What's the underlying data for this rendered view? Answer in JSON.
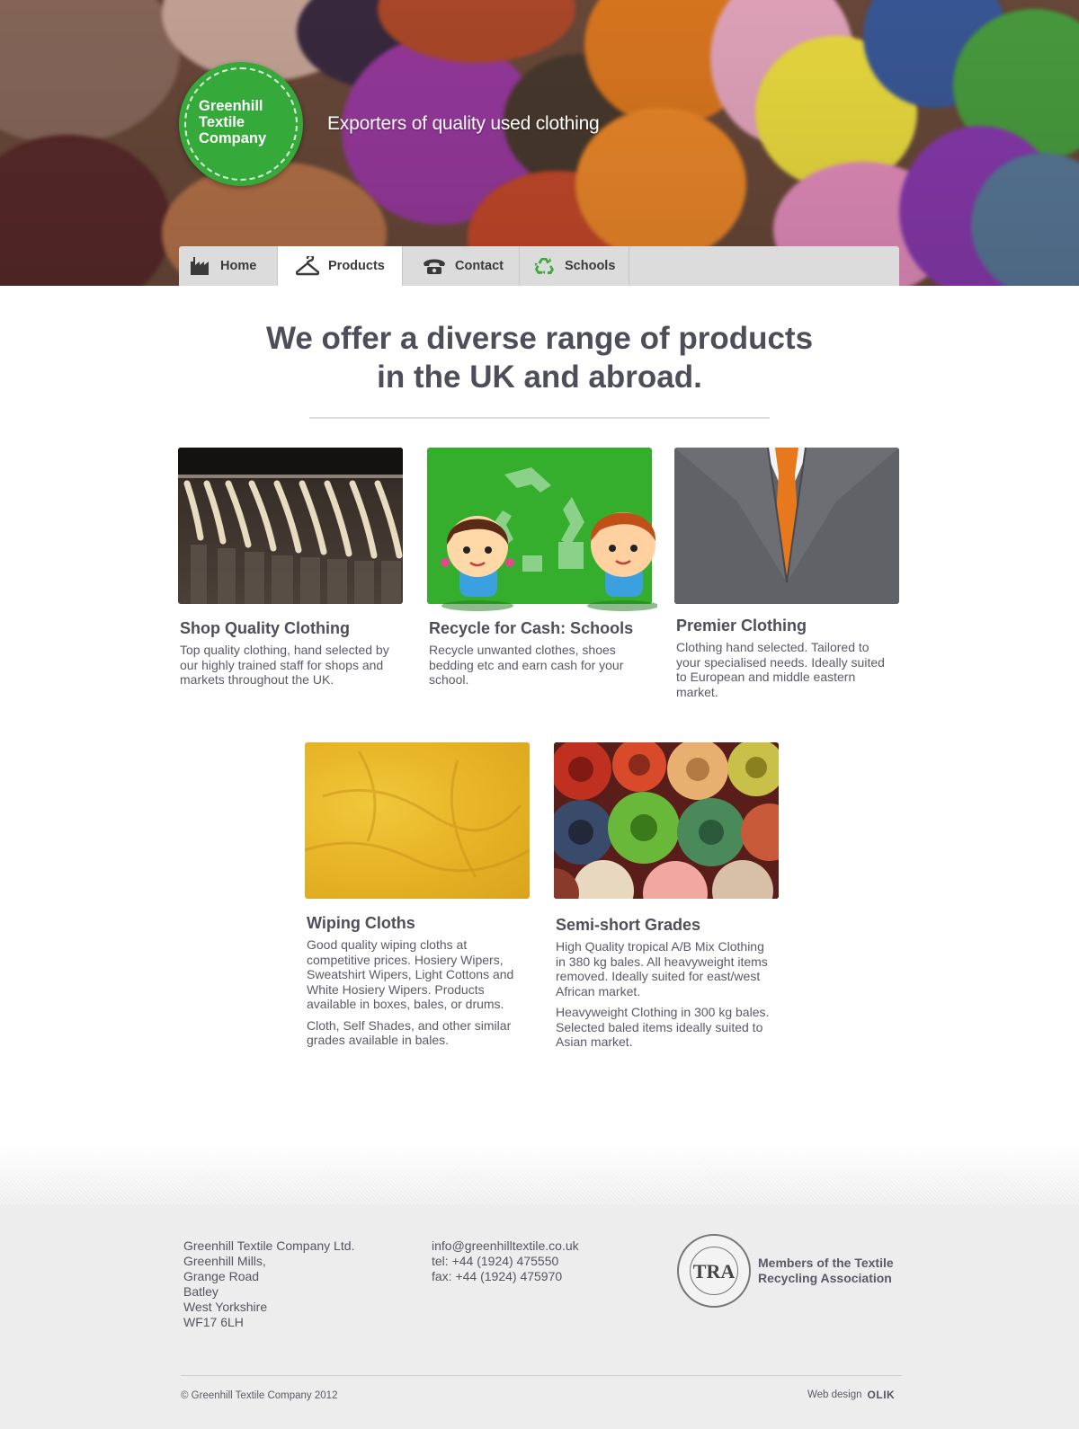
{
  "brand": {
    "name": "Greenhill\nTextile\nCompany",
    "tagline": "Exporters of quality used clothing",
    "accent": "#35a93a"
  },
  "nav": {
    "items": [
      {
        "label": "Home",
        "icon": "factory-icon",
        "active": false
      },
      {
        "label": "Products",
        "icon": "hanger-icon",
        "active": true
      },
      {
        "label": "Contact",
        "icon": "telephone-icon",
        "active": false
      },
      {
        "label": "Schools",
        "icon": "recycle-icon",
        "active": false
      }
    ]
  },
  "headline": "We offer a diverse range of products\nin the UK and abroad.",
  "products": [
    {
      "title": "Shop Quality Clothing",
      "paragraphs": [
        "Top quality clothing, hand selected by our highly trained staff for shops and markets throughout the UK."
      ]
    },
    {
      "title": "Recycle for Cash: Schools",
      "paragraphs": [
        "Recycle unwanted clothes, shoes bedding etc and earn cash for your school."
      ]
    },
    {
      "title": "Premier Clothing",
      "paragraphs": [
        "Clothing hand selected. Tailored to your specialised needs. Ideally suited to European and middle eastern market."
      ]
    },
    {
      "title": "Wiping Cloths",
      "paragraphs": [
        "Good quality wiping cloths at competitive prices. Hosiery Wipers, Sweatshirt Wipers, Light Cottons and White Hosiery Wipers. Products available in boxes, bales, or drums.",
        "Cloth, Self Shades, and other similar grades available in bales."
      ]
    },
    {
      "title": "Semi-short Grades",
      "paragraphs": [
        "High Quality tropical A/B Mix Clothing in 380 kg bales. All heavyweight items removed. Ideally suited for east/west African market.",
        "Heavyweight Clothing in 300 kg bales. Selected baled items ideally suited to Asian market."
      ]
    }
  ],
  "footer": {
    "address": [
      "Greenhill Textile Company Ltd.",
      "Greenhill Mills,",
      "Grange Road",
      "Batley",
      "West Yorkshire",
      "WF17 6LH"
    ],
    "email": "info@greenhilltextile.co.uk",
    "tel": "tel: +44 (1924) 475550",
    "fax": "fax: +44 (1924) 475970",
    "tra_seal": "TRA",
    "tra_text": "Members of the Textile\nRecycling Association",
    "copyright": "© Greenhill Textile Company 2012",
    "credit_label": "Web design",
    "credit_logo": "OLIK"
  }
}
